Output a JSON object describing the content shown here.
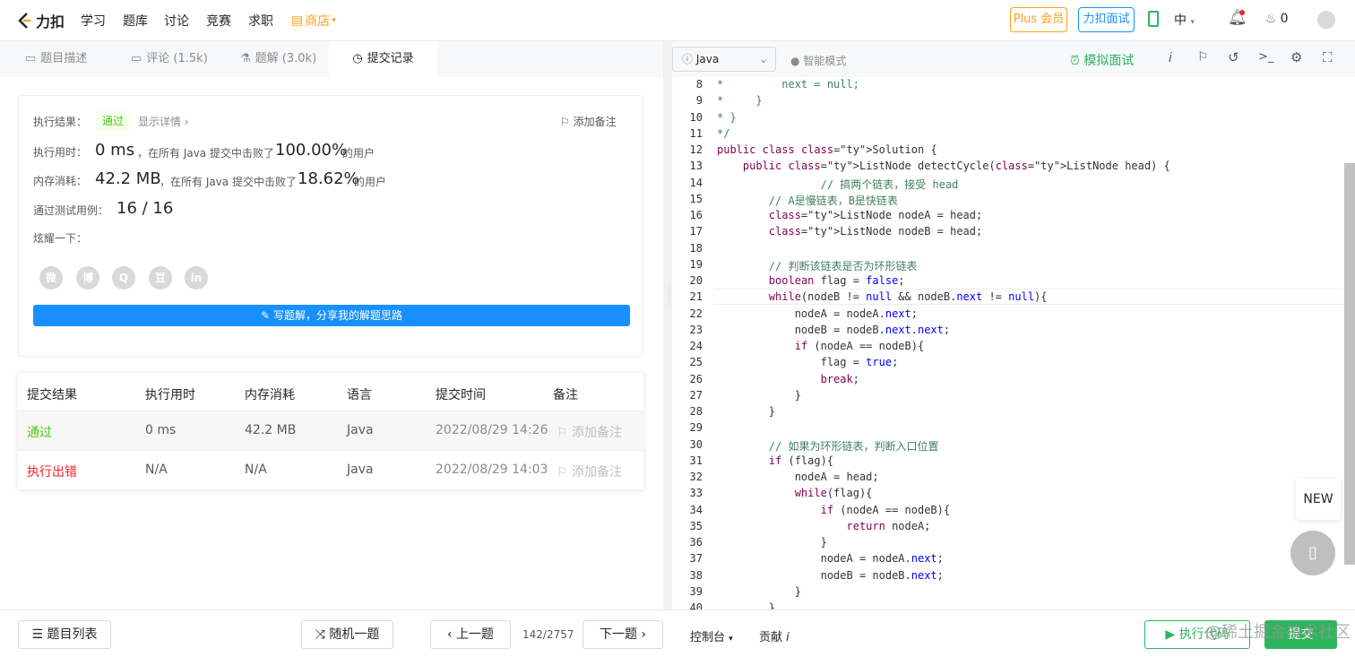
{
  "nav": {
    "logo": "力扣",
    "items": [
      "学习",
      "题库",
      "讨论",
      "竞赛",
      "求职"
    ],
    "shop": "商店",
    "plus": "Plus 会员",
    "interview": "力扣面试",
    "lang": "中",
    "points": "0"
  },
  "tabs": [
    {
      "label": "题目描述"
    },
    {
      "label": "评论 (1.5k)"
    },
    {
      "label": "题解 (3.0k)"
    },
    {
      "label": "提交记录"
    }
  ],
  "result": {
    "label": "执行结果：",
    "status": "通过",
    "detail": "显示详情",
    "add_note": "添加备注",
    "time_label": "执行用时：",
    "time_value": "0 ms",
    "time_beat": "，在所有 Java 提交中击败了",
    "time_pct": "100.00%",
    "time_users": "的用户",
    "mem_label": "内存消耗：",
    "mem_value": "42.2 MB",
    "mem_beat": "，在所有 Java 提交中击败了",
    "mem_pct": "18.62%",
    "mem_users": "的用户",
    "tests_label": "通过测试用例：",
    "tests_value": "16 / 16",
    "share_label": "炫耀一下：",
    "write_btn": "写题解，分享我的解题思路"
  },
  "share_icons": [
    "wechat-icon",
    "weibo-icon",
    "qq-icon",
    "douban-icon",
    "linkedin-icon"
  ],
  "share_glyphs": [
    "微",
    "博",
    "Q",
    "豆",
    "in"
  ],
  "table": {
    "headers": [
      "提交结果",
      "执行用时",
      "内存消耗",
      "语言",
      "提交时间",
      "备注"
    ],
    "rows": [
      {
        "status": "通过",
        "time": "0 ms",
        "mem": "42.2 MB",
        "lang": "Java",
        "when": "2022/08/29 14:26",
        "note": "添加备注"
      },
      {
        "status": "执行出错",
        "time": "N/A",
        "mem": "N/A",
        "lang": "Java",
        "when": "2022/08/29 14:03",
        "note": "添加备注"
      }
    ]
  },
  "editor": {
    "language": "Java",
    "mode": "智能模式",
    "mock": "模拟面试",
    "new_badge": "NEW",
    "lines": [
      {
        "n": "8",
        "code": "*         next = null;"
      },
      {
        "n": "9",
        "code": "*     }"
      },
      {
        "n": "10",
        "code": "* }"
      },
      {
        "n": "11",
        "code": "*/"
      },
      {
        "n": "12",
        "code": "public class Solution {"
      },
      {
        "n": "13",
        "code": "    public ListNode detectCycle(ListNode head) {"
      },
      {
        "n": "14",
        "code": "                // 搞两个链表，接受 head"
      },
      {
        "n": "15",
        "code": "        // A是慢链表，B是快链表"
      },
      {
        "n": "16",
        "code": "        ListNode nodeA = head;"
      },
      {
        "n": "17",
        "code": "        ListNode nodeB = head;"
      },
      {
        "n": "18",
        "code": ""
      },
      {
        "n": "19",
        "code": "        // 判断该链表是否为环形链表"
      },
      {
        "n": "20",
        "code": "        boolean flag = false;"
      },
      {
        "n": "21",
        "code": "        while(nodeB != null && nodeB.next != null){"
      },
      {
        "n": "22",
        "code": "            nodeA = nodeA.next;"
      },
      {
        "n": "23",
        "code": "            nodeB = nodeB.next.next;"
      },
      {
        "n": "24",
        "code": "            if (nodeA == nodeB){"
      },
      {
        "n": "25",
        "code": "                flag = true;"
      },
      {
        "n": "26",
        "code": "                break;"
      },
      {
        "n": "27",
        "code": "            }"
      },
      {
        "n": "28",
        "code": "        }"
      },
      {
        "n": "29",
        "code": ""
      },
      {
        "n": "30",
        "code": "        // 如果为环形链表，判断入口位置"
      },
      {
        "n": "31",
        "code": "        if (flag){"
      },
      {
        "n": "32",
        "code": "            nodeA = head;"
      },
      {
        "n": "33",
        "code": "            while(flag){"
      },
      {
        "n": "34",
        "code": "                if (nodeA == nodeB){"
      },
      {
        "n": "35",
        "code": "                    return nodeA;"
      },
      {
        "n": "36",
        "code": "                }"
      },
      {
        "n": "37",
        "code": "                nodeA = nodeA.next;"
      },
      {
        "n": "38",
        "code": "                nodeB = nodeB.next;"
      },
      {
        "n": "39",
        "code": "            }"
      },
      {
        "n": "40",
        "code": "        }"
      }
    ]
  },
  "bottom": {
    "list": "题目列表",
    "random": "随机一题",
    "prev": "上一题",
    "page": "142/2757",
    "next": "下一题",
    "console": "控制台",
    "contribute": "贡献",
    "run": "执行代码",
    "submit": "提交",
    "watermark": "@稀土掘金技术社区"
  },
  "colors": {
    "accent": "#1890ff",
    "pass": "#52c41a",
    "error": "#f5222d",
    "submit": "#2db55d",
    "shop": "#ffa116"
  }
}
